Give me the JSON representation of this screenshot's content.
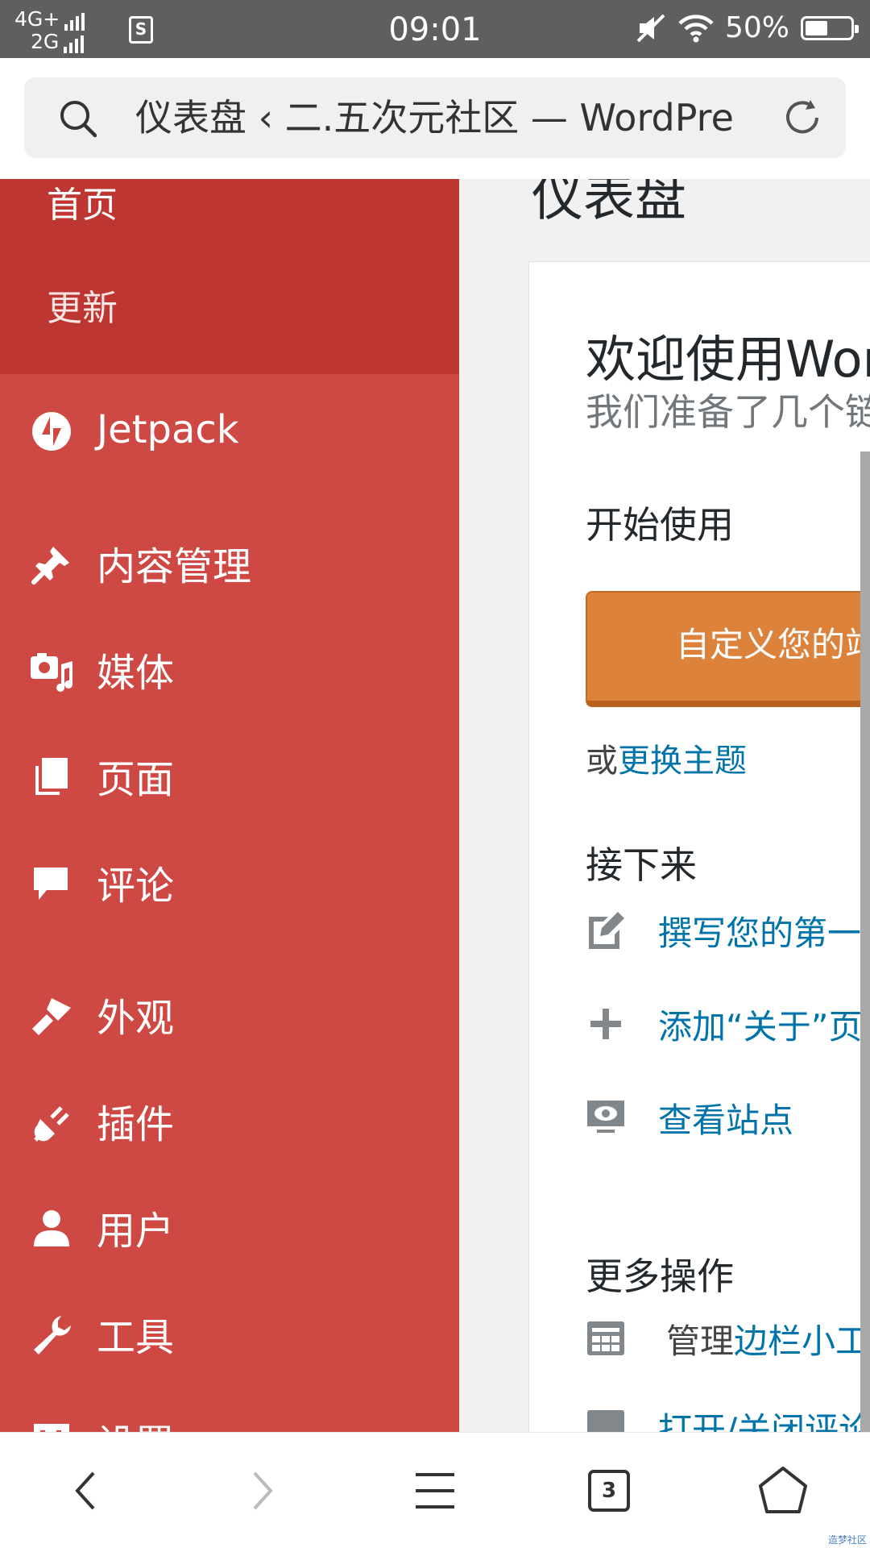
{
  "status_bar": {
    "network_top": "4G+",
    "network_bottom": "2G",
    "time": "09:01",
    "battery": "50%",
    "battery_level": 0.5
  },
  "address_bar": {
    "url_text": "仪表盘 ‹ 二.五次元社区 — WordPre"
  },
  "sidebar": {
    "submenu": [
      {
        "label": "首页"
      },
      {
        "label": "更新"
      }
    ],
    "items": [
      {
        "label": "Jetpack",
        "icon": "jetpack-icon"
      },
      {
        "label": "内容管理",
        "icon": "pin-icon"
      },
      {
        "label": "媒体",
        "icon": "media-icon"
      },
      {
        "label": "页面",
        "icon": "pages-icon"
      },
      {
        "label": "评论",
        "icon": "comment-icon"
      },
      {
        "label": "外观",
        "icon": "appearance-brush-icon"
      },
      {
        "label": "插件",
        "icon": "plugin-icon"
      },
      {
        "label": "用户",
        "icon": "user-icon"
      },
      {
        "label": "工具",
        "icon": "wrench-icon"
      },
      {
        "label": "设置",
        "icon": "settings-icon"
      }
    ],
    "colors": {
      "menu_bg": "#cf4944",
      "submenu_bg": "#be3631"
    }
  },
  "main": {
    "page_title": "仪表盘",
    "welcome": {
      "title": "欢迎使用Wor",
      "about": "我们准备了几个链"
    },
    "get_started": {
      "heading": "开始使用",
      "button": "自定义您的站",
      "or_text": "或",
      "change_theme": "更换主题"
    },
    "next_steps": {
      "heading": "接下来",
      "items": [
        {
          "label": "撰写您的第一篇",
          "icon": "edit-icon"
        },
        {
          "label": "添加“关于”页",
          "icon": "plus-icon"
        },
        {
          "label": "查看站点",
          "icon": "view-site-icon"
        }
      ]
    },
    "more_actions": {
      "heading": "更多操作",
      "manage_prefix": "管理",
      "manage_link": "边栏小工",
      "second_link": "打开/关闭评论"
    },
    "colors": {
      "accent_button": "#dd823b",
      "link": "#0073aa"
    }
  },
  "bottom_nav": {
    "tabs_count": "3",
    "watermark": "造梦社区"
  }
}
